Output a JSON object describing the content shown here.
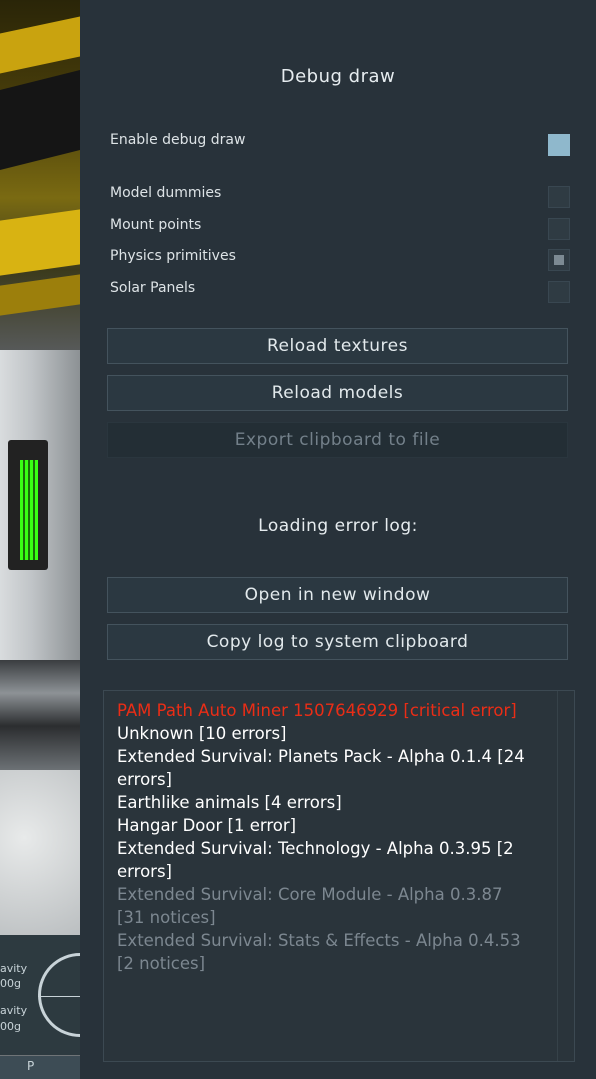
{
  "scene": {
    "hud": {
      "gravity_label_1": "avity",
      "gravity_value_1": "00g",
      "gravity_label_2": "avity",
      "gravity_value_2": "00g",
      "key_hint": "P"
    }
  },
  "debug_draw": {
    "title": "Debug draw",
    "enable": {
      "label": "Enable debug draw",
      "checked": true
    },
    "options": [
      {
        "label": "Model dummies",
        "checked": false
      },
      {
        "label": "Mount points",
        "checked": false
      },
      {
        "label": "Physics primitives",
        "checked": "indeterminate"
      },
      {
        "label": "Solar Panels",
        "checked": false
      }
    ],
    "buttons": {
      "reload_textures": "Reload textures",
      "reload_models": "Reload models",
      "export_clipboard": "Export clipboard to file"
    }
  },
  "error_log": {
    "title": "Loading error log:",
    "buttons": {
      "open_window": "Open in new window",
      "copy_log": "Copy log to system clipboard"
    },
    "entries": [
      {
        "text": "PAM Path Auto Miner 1507646929 [critical error]",
        "severity": "critical"
      },
      {
        "text": "Unknown [10 errors]",
        "severity": "error"
      },
      {
        "text": "Extended Survival: Planets Pack - Alpha 0.1.4 [24 errors]",
        "severity": "error"
      },
      {
        "text": "Earthlike animals [4 errors]",
        "severity": "error"
      },
      {
        "text": "Hangar Door [1 error]",
        "severity": "error"
      },
      {
        "text": "Extended Survival: Technology - Alpha 0.3.95 [2 errors]",
        "severity": "error"
      },
      {
        "text": "Extended Survival: Core Module - Alpha 0.3.87 [31 notices]",
        "severity": "notice"
      },
      {
        "text": "Extended Survival: Stats & Effects - Alpha 0.4.53 [2 notices]",
        "severity": "notice"
      }
    ]
  },
  "colors": {
    "critical": "#ea2d16",
    "error": "#ffffff",
    "notice": "#7c8790",
    "checkbox_checked": "#8fb8cc"
  }
}
